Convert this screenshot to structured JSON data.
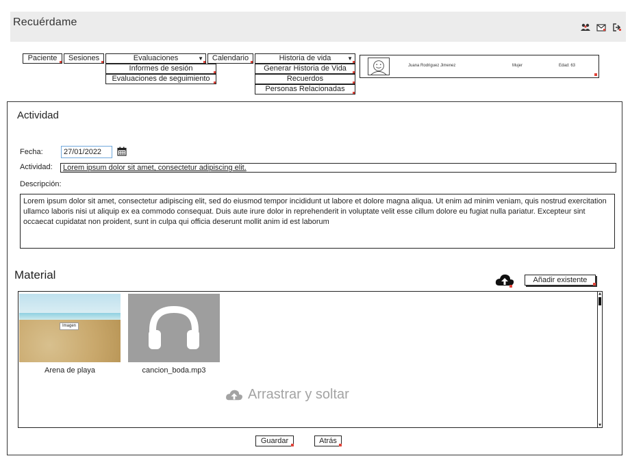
{
  "app": {
    "title": "Recuérdame"
  },
  "header_icons": [
    "users-icon",
    "mail-icon",
    "logout-icon"
  ],
  "nav": {
    "paciente": "Paciente",
    "sesiones": "Sesiones",
    "evaluaciones": "Evaluaciones",
    "evaluaciones_items": [
      "Informes de sesión",
      "Evaluaciones de seguimiento"
    ],
    "calendario": "Calendario",
    "historia": "Historia de vida",
    "historia_items": [
      "Generar Historia de Vida",
      "Recuerdos",
      "Personas Relacionadas"
    ]
  },
  "patient": {
    "name": "Juana Rodriguez Jimenez",
    "gender": "Mujer",
    "age": "Edad: 63"
  },
  "activity": {
    "title": "Actividad",
    "date_label": "Fecha:",
    "date_value": "27/01/2022",
    "activity_label": "Actividad:",
    "activity_value": "Lorem ipsum dolor sit amet, consectetur adipiscing elit.",
    "description_label": "Descripción:",
    "description_value": "Lorem ipsum dolor sit amet, consectetur adipiscing elit, sed do eiusmod tempor incididunt ut labore et dolore magna aliqua. Ut enim ad minim veniam, quis nostrud exercitation ullamco laboris nisi ut aliquip ex ea commodo consequat. Duis aute irure dolor in reprehenderit in voluptate velit esse cillum dolore eu fugiat nulla pariatur. Excepteur sint occaecat cupidatat non proident, sunt in culpa qui officia deserunt mollit anim id est laborum"
  },
  "material": {
    "title": "Material",
    "add_existing": "Añadir existente",
    "items": [
      {
        "caption": "Arena de playa",
        "tag": "Imagen"
      },
      {
        "caption": "cancion_boda.mp3"
      }
    ],
    "dropzone": "Arrastrar y soltar"
  },
  "actions": {
    "save": "Guardar",
    "back": "Atrás"
  },
  "colors": {
    "accent_marker": "#e0443a",
    "focus_border": "#6fa8dc",
    "header_bg": "#ececec"
  }
}
